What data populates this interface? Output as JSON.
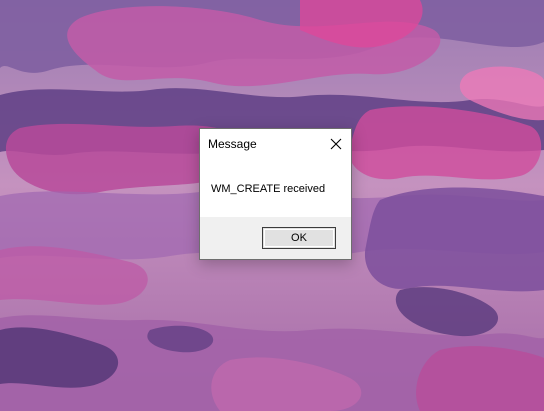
{
  "dialog": {
    "title": "Message",
    "message": "WM_CREATE received",
    "ok_label": "OK",
    "close_icon": "close-icon"
  },
  "colors": {
    "dialog_background": "#ffffff",
    "footer_background": "#f0f0f0",
    "button_background": "#e1e1e1",
    "button_border": "#3c3c3c",
    "dialog_border": "#6e6e6e"
  }
}
